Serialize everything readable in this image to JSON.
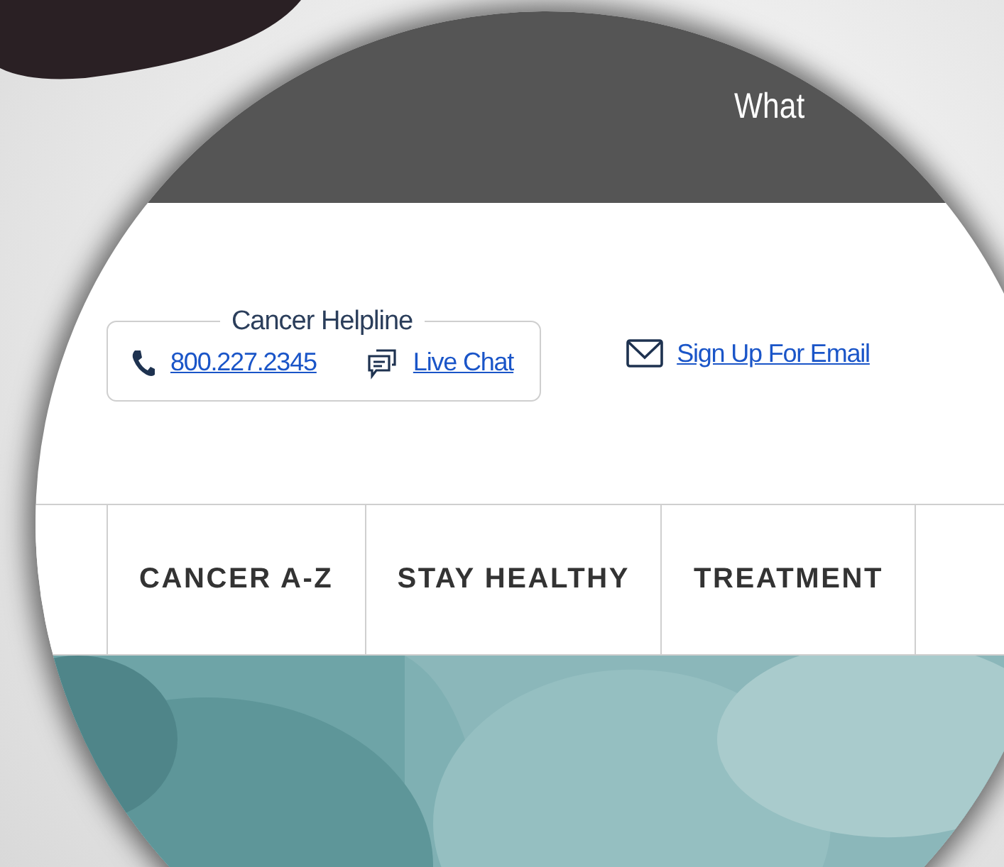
{
  "top_bar": {
    "text": "What"
  },
  "helpline": {
    "title": "Cancer Helpline",
    "phone": "800.227.2345",
    "chat": "Live Chat"
  },
  "email_link": "Sign Up For Email",
  "nav": {
    "items": [
      {
        "kind": "cut"
      },
      {
        "label": "CANCER A-Z"
      },
      {
        "label": "STAY HEALTHY"
      },
      {
        "label": "TREATMENT"
      }
    ]
  }
}
